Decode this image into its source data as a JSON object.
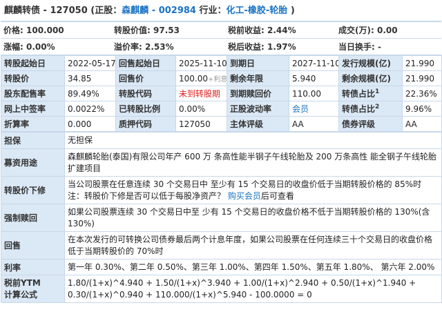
{
  "header": {
    "bond_name": "麒麟转债",
    "bond_code": "127050",
    "stock_label": "(正股：",
    "stock_name": "森麒麟",
    "stock_sep": " - ",
    "stock_code": "002984",
    "industry_label": " 行业：",
    "industry_value": "化工-橡胶-轮胎",
    "close_paren": " )"
  },
  "price_rows": [
    [
      {
        "label": "价格:",
        "value": "100.000"
      },
      {
        "label": "转股价值:",
        "value": "97.53"
      },
      {
        "label": "税前收益:",
        "value": "2.44%"
      },
      {
        "label": "成交(万):",
        "value": "0.00"
      }
    ],
    [
      {
        "label": "涨幅:",
        "value": "0.00%"
      },
      {
        "label": "溢价率:",
        "value": "2.53%"
      },
      {
        "label": "税后收益:",
        "value": "1.97%"
      },
      {
        "label": "当日换手:",
        "value": "-"
      }
    ]
  ],
  "grid": {
    "r1": {
      "h1": "转股起始日",
      "v1": "2022-05-17",
      "h2": "回售起始日",
      "v2": "2025-11-10",
      "h3": "到期日",
      "v3": "2027-11-10",
      "h4": "发行规模(亿)",
      "v4": "21.990"
    },
    "r2": {
      "h1": "转股价",
      "v1": "34.85",
      "h2": "回售价",
      "v2a": "100.00",
      "v2b": "+利息",
      "h3": "剩余年限",
      "v3": "5.940",
      "h4": "剩余规模(亿)",
      "v4": "21.990"
    },
    "r3": {
      "h1": "股东配售率",
      "v1": "89.49%",
      "h2": "转股代码",
      "v2": "未到转股期",
      "h3": "到期赎回价",
      "v3": "110.00",
      "h4": "转债占比",
      "h4sup": "1",
      "v4": "22.36%"
    },
    "r4": {
      "h1": "网上中签率",
      "v1": "0.0022%",
      "h2": "已转股比例",
      "v2": "0.00%",
      "h3": "正股波动率",
      "v3": "会员",
      "h4": "转债占比",
      "h4sup": "2",
      "v4": "9.96%"
    },
    "r5": {
      "h1": "折算率",
      "v1": "0.000",
      "h2": "质押代码",
      "v2": "127050",
      "h3": "主体评级",
      "v3": "AA",
      "h4": "债券评级",
      "v4": "AA"
    }
  },
  "details": {
    "guarantee": {
      "label": "担保",
      "value": "无担保"
    },
    "purpose": {
      "label": "募资用途",
      "value": "森麒麟轮胎(泰国)有限公司年产 600 万 条高性能半钢子午线轮胎及 200 万条高性 能全钢子午线轮胎扩建项目"
    },
    "downward": {
      "label": "转股价下修",
      "value": "当公司股票在任意连续 30 个交易日中 至少有 15 个交易日的收盘价低于当期转股价格的 85%时",
      "note_prefix": "注：转股价下修是否可以低于每股净资产？ ",
      "note_link": "购买会员",
      "note_suffix": "后可查看"
    },
    "call": {
      "label": "强制赎回",
      "value": "如果公司股票连续 30 个交易日中至 少有 15 个交易日的收盘价格不低于当期转股价格的 130%(含 130%)"
    },
    "put": {
      "label": "回售",
      "value": "在本次发行的可转换公司债券最后两个计息年度，如果公司股票在任何连续三十个交易日的收盘价格低于当期转股价的 70%时"
    },
    "rate": {
      "label": "利率",
      "value": "第一年 0.30%、第二年 0.50%、第三年 1.00%、第四年 1.50%、第五年 1.80%、 第六年 2.00%"
    },
    "ytm": {
      "label_line1": "税前YTM",
      "label_line2": "计算公式",
      "value": "1.80/(1+x)^4.940 + 1.50/(1+x)^3.940 + 1.00/(1+x)^2.940 + 0.50/(1+x)^1.940 + 0.30/(1+x)^0.940 + 110.000/(1+x)^5.940 - 100.0000 = 0"
    }
  },
  "colors": {
    "header_bg": "#dbe8f5",
    "border": "#c7d8ea",
    "link": "#1a73c4",
    "alert": "#e02020"
  }
}
